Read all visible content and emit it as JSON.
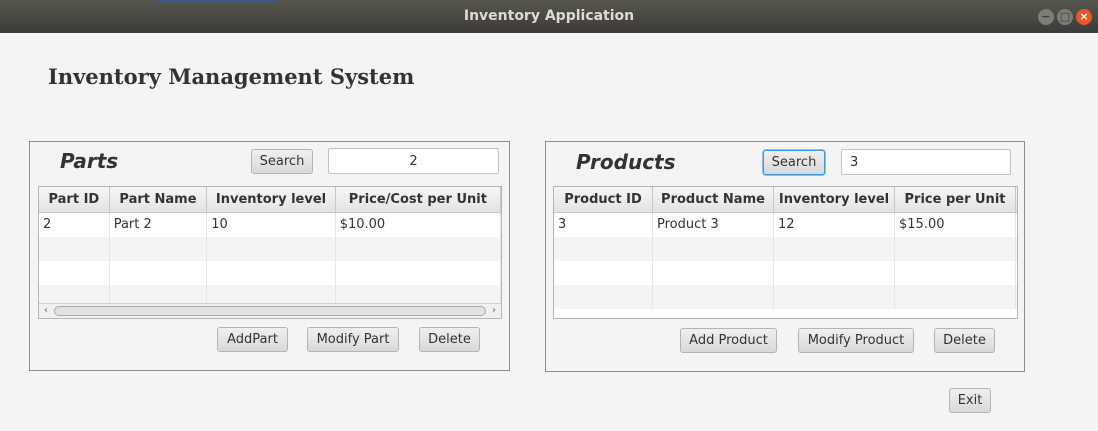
{
  "window": {
    "title": "Inventory Application",
    "minimize_glyph": "−",
    "maximize_glyph": "□",
    "close_glyph": "×"
  },
  "app_title": "Inventory Management System",
  "parts": {
    "title": "Parts",
    "search_label": "Search",
    "search_value": "2",
    "columns": [
      "Part ID",
      "Part Name",
      "Inventory level",
      "Price/Cost per Unit"
    ],
    "rows": [
      [
        "2",
        "Part 2",
        "10",
        "$10.00"
      ]
    ],
    "scroll_left": "‹",
    "scroll_right": "›",
    "add_label": "AddPart",
    "modify_label": "Modify Part",
    "delete_label": "Delete"
  },
  "products": {
    "title": "Products",
    "search_label": "Search",
    "search_value": "3",
    "columns": [
      "Product ID",
      "Product Name",
      "Inventory level",
      "Price per Unit"
    ],
    "rows": [
      [
        "3",
        "Product 3",
        "12",
        "$15.00"
      ]
    ],
    "add_label": "Add Product",
    "modify_label": "Modify Product",
    "delete_label": "Delete"
  },
  "exit_label": "Exit",
  "colors": {
    "titlebar": "#3c3b37",
    "close_button": "#e9582b",
    "focus_ring": "#3d97d8"
  }
}
